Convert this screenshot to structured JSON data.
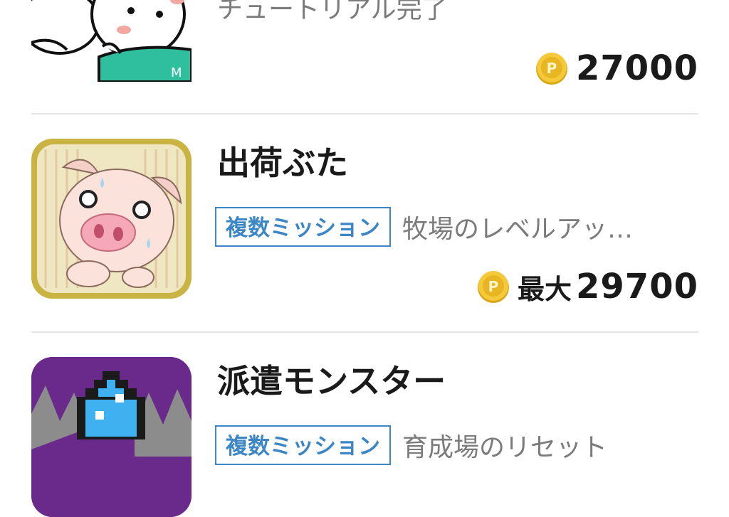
{
  "items": [
    {
      "icon": "cartoon-character-app-icon",
      "subtitle": "チュートリアル完了",
      "reward_points": "27000"
    },
    {
      "icon": "pig-app-icon",
      "title": "出荷ぶた",
      "badge": "複数ミッション",
      "description": "牧場のレベルアッ…",
      "reward_prefix": "最大",
      "reward_points": "29700"
    },
    {
      "icon": "pixel-monster-app-icon",
      "title": "派遣モンスター",
      "badge": "複数ミッション",
      "description": "育成場のリセット"
    }
  ],
  "colors": {
    "badge": "#3d86c6",
    "coin": "#f2c12e",
    "divider": "#e4e4e4",
    "text_secondary": "#7b7b7b"
  }
}
